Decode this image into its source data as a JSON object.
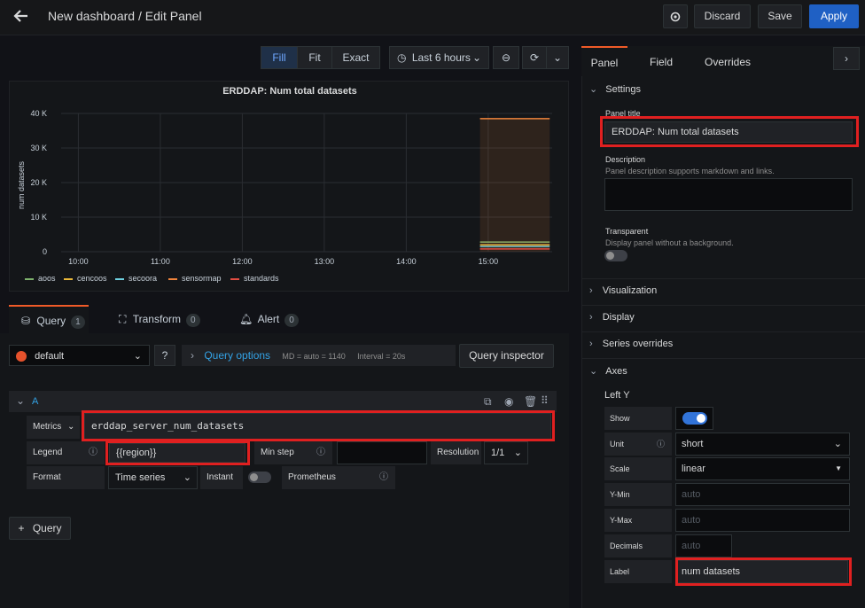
{
  "header": {
    "title": "New dashboard / Edit Panel",
    "discard_label": "Discard",
    "save_label": "Save",
    "apply_label": "Apply"
  },
  "toolbar": {
    "fill_label": "Fill",
    "fit_label": "Fit",
    "exact_label": "Exact",
    "time_range": "Last 6 hours"
  },
  "chart_data": {
    "type": "line",
    "title": "ERDDAP: Num total datasets",
    "ylabel": "num datasets",
    "xlabel": "",
    "ylim": [
      0,
      40000
    ],
    "y_ticks": [
      "0",
      "10 K",
      "20 K",
      "30 K",
      "40 K"
    ],
    "x_ticks": [
      "10:00",
      "11:00",
      "12:00",
      "13:00",
      "14:00",
      "15:00"
    ],
    "series": [
      {
        "name": "aoos",
        "color": "#7eb26d",
        "values": [
          2800,
          2800
        ]
      },
      {
        "name": "cencoos",
        "color": "#eab839",
        "values": [
          2000,
          2000
        ]
      },
      {
        "name": "secoora",
        "color": "#6ed0e0",
        "values": [
          1500,
          1500
        ]
      },
      {
        "name": "sensormap",
        "color": "#ef843c",
        "values": [
          38500,
          38500
        ]
      },
      {
        "name": "standards",
        "color": "#e24d42",
        "values": [
          800,
          800
        ]
      }
    ],
    "x_range_hours": [
      14.9,
      15.75
    ],
    "legend_position": "bottom-left",
    "grid": true
  },
  "query_tabs": [
    {
      "label": "Query",
      "count": "1"
    },
    {
      "label": "Transform",
      "count": "0"
    },
    {
      "label": "Alert",
      "count": "0"
    }
  ],
  "query": {
    "datasource": "default",
    "options_label": "Query options",
    "options_md": "MD = auto = 1140",
    "options_interval": "Interval = 20s",
    "inspector_label": "Query inspector",
    "ref_id": "A",
    "metrics_label": "Metrics",
    "metrics_value": "erddap_server_num_datasets",
    "legend_label": "Legend",
    "legend_value": "{{region}}",
    "min_step_label": "Min step",
    "resolution_label": "Resolution",
    "resolution_value": "1/1",
    "format_label": "Format",
    "format_value": "Time series",
    "instant_label": "Instant",
    "prometheus_label": "Prometheus",
    "add_query_label": "Query"
  },
  "right": {
    "tabs": [
      "Panel",
      "Field",
      "Overrides"
    ],
    "settings_title": "Settings",
    "panel_title_label": "Panel title",
    "panel_title_value": "ERDDAP: Num total datasets",
    "description_label": "Description",
    "description_help": "Panel description supports markdown and links.",
    "transparent_label": "Transparent",
    "transparent_help": "Display panel without a background.",
    "visualization": "Visualization",
    "display": "Display",
    "series_overrides": "Series overrides",
    "axes": "Axes",
    "left_y": "Left Y",
    "show_label": "Show",
    "unit_label": "Unit",
    "unit_value": "short",
    "scale_label": "Scale",
    "scale_value": "linear",
    "ymin_label": "Y-Min",
    "ymin_placeholder": "auto",
    "ymax_label": "Y-Max",
    "ymax_placeholder": "auto",
    "decimals_label": "Decimals",
    "decimals_placeholder": "auto",
    "label_label": "Label",
    "label_value": "num datasets"
  }
}
